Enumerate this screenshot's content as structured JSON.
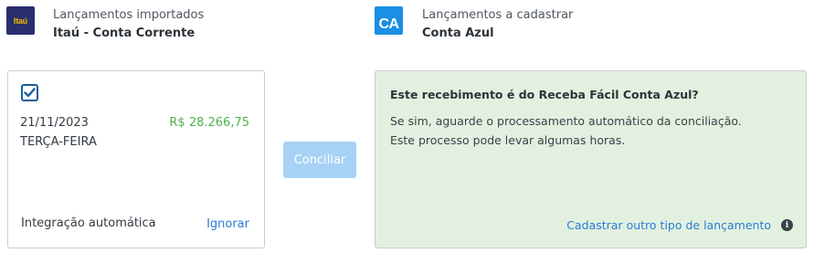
{
  "left_header": {
    "logo_text": "Itaú",
    "subtitle": "Lançamentos importados",
    "title": "Itaú - Conta Corrente"
  },
  "right_header": {
    "logo_text": "CA",
    "subtitle": "Lançamentos a cadastrar",
    "title": "Conta Azul"
  },
  "transaction": {
    "checked": true,
    "date": "21/11/2023",
    "weekday": "TERÇA-FEIRA",
    "amount": "R$ 28.266,75",
    "integration": "Integração automática",
    "ignore_label": "Ignorar"
  },
  "conciliar_label": "Conciliar",
  "info_panel": {
    "title": "Este recebimento é do Receba Fácil Conta Azul?",
    "line1": "Se sim, aguarde o processamento automático da conciliação.",
    "line2": "Este processo pode levar algumas horas.",
    "link": "Cadastrar outro tipo de lançamento",
    "info_icon": "i"
  },
  "colors": {
    "itau_bg": "#2a2e6e",
    "itau_text": "#f5b800",
    "contaazul_bg": "#1a8fe3",
    "amount_green": "#4fb04c",
    "link_blue": "#2a7bd6",
    "button_disabled": "#a7d2f5",
    "panel_green": "#e2f1df"
  }
}
